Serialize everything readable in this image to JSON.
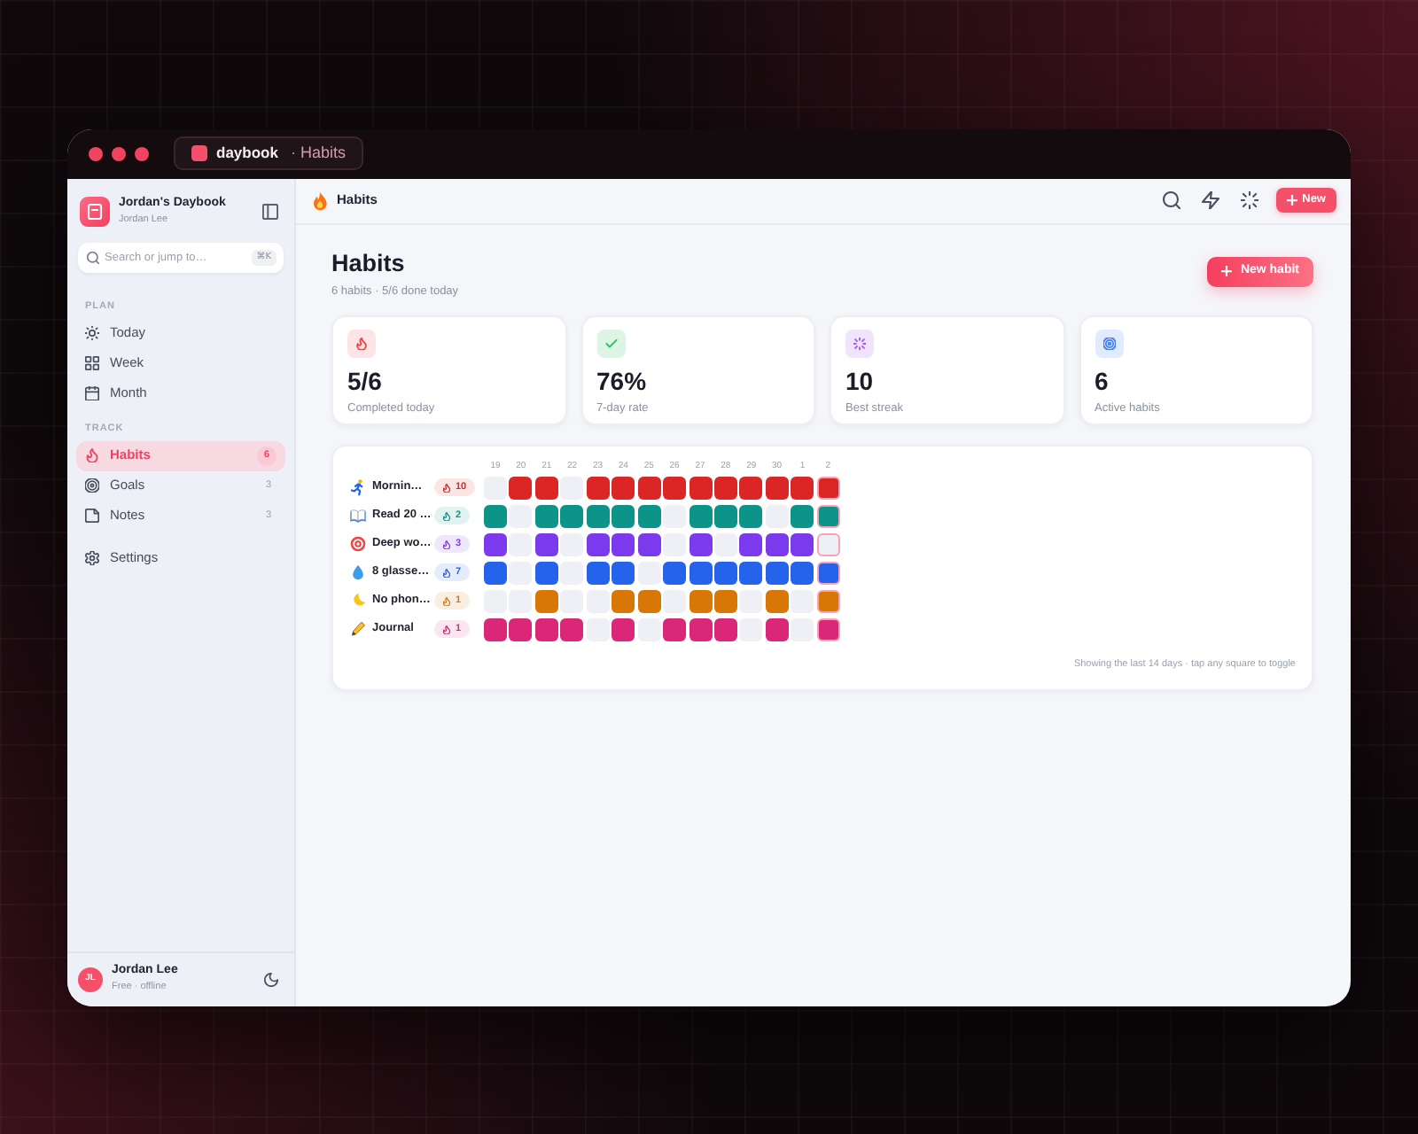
{
  "window": {
    "app_name": "daybook",
    "page_name": "· Habits"
  },
  "sidebar": {
    "workspace": {
      "title": "Jordan's Daybook",
      "subtitle": "Jordan Lee"
    },
    "search": {
      "placeholder": "Search or jump to…",
      "shortcut": "⌘K"
    },
    "sections": [
      {
        "label": "PLAN",
        "items": [
          {
            "label": "Today",
            "selected": false
          },
          {
            "label": "Week",
            "selected": false
          },
          {
            "label": "Month",
            "selected": false
          }
        ]
      },
      {
        "label": "TRACK",
        "items": [
          {
            "label": "Habits",
            "count": "6",
            "selected": true
          },
          {
            "label": "Goals",
            "count": "3",
            "selected": false
          },
          {
            "label": "Notes",
            "count": "3",
            "selected": false
          }
        ]
      },
      {
        "items": [
          {
            "label": "Settings",
            "selected": false
          }
        ]
      }
    ],
    "user": {
      "initials": "JL",
      "name": "Jordan Lee",
      "status": "Free · offline"
    }
  },
  "topbar": {
    "title": "Habits",
    "new_button": "New"
  },
  "page": {
    "title": "Habits",
    "subtitle": "6 habits · 5/6 done today",
    "new_button": "New habit"
  },
  "stats": [
    {
      "value": "5/6",
      "label": "Completed today"
    },
    {
      "value": "76%",
      "label": "7-day rate"
    },
    {
      "value": "10",
      "label": "Best streak"
    },
    {
      "value": "6",
      "label": "Active habits"
    }
  ],
  "tracker": {
    "days": [
      {
        "label": "19",
        "today": false
      },
      {
        "label": "20",
        "today": false
      },
      {
        "label": "21",
        "today": false
      },
      {
        "label": "22",
        "today": false
      },
      {
        "label": "23",
        "today": false
      },
      {
        "label": "24",
        "today": false
      },
      {
        "label": "25",
        "today": false
      },
      {
        "label": "26",
        "today": false
      },
      {
        "label": "27",
        "today": false
      },
      {
        "label": "28",
        "today": false
      },
      {
        "label": "29",
        "today": false
      },
      {
        "label": "30",
        "today": false
      },
      {
        "label": "1",
        "today": false
      },
      {
        "label": "2",
        "today": true
      }
    ],
    "habits": [
      {
        "name": "Mornin…",
        "streak": "10",
        "color": "#dc2626",
        "days": [
          {
            "done": false
          },
          {
            "done": true
          },
          {
            "done": true
          },
          {
            "done": false
          },
          {
            "done": true
          },
          {
            "done": true
          },
          {
            "done": true
          },
          {
            "done": true
          },
          {
            "done": true
          },
          {
            "done": true
          },
          {
            "done": true
          },
          {
            "done": true
          },
          {
            "done": true
          },
          {
            "done": true
          }
        ]
      },
      {
        "name": "Read 20 …",
        "streak": "2",
        "color": "#0d9488",
        "days": [
          {
            "done": true
          },
          {
            "done": false
          },
          {
            "done": true
          },
          {
            "done": true
          },
          {
            "done": true
          },
          {
            "done": true
          },
          {
            "done": true
          },
          {
            "done": false
          },
          {
            "done": true
          },
          {
            "done": true
          },
          {
            "done": true
          },
          {
            "done": false
          },
          {
            "done": true
          },
          {
            "done": true
          }
        ]
      },
      {
        "name": "Deep wo…",
        "streak": "3",
        "color": "#7c3aed",
        "days": [
          {
            "done": true
          },
          {
            "done": false
          },
          {
            "done": true
          },
          {
            "done": false
          },
          {
            "done": true
          },
          {
            "done": true
          },
          {
            "done": true
          },
          {
            "done": false
          },
          {
            "done": true
          },
          {
            "done": false
          },
          {
            "done": true
          },
          {
            "done": true
          },
          {
            "done": true
          },
          {
            "done": false
          }
        ]
      },
      {
        "name": "8 glasse…",
        "streak": "7",
        "color": "#2563eb",
        "days": [
          {
            "done": true
          },
          {
            "done": false
          },
          {
            "done": true
          },
          {
            "done": false
          },
          {
            "done": true
          },
          {
            "done": true
          },
          {
            "done": false
          },
          {
            "done": true
          },
          {
            "done": true
          },
          {
            "done": true
          },
          {
            "done": true
          },
          {
            "done": true
          },
          {
            "done": true
          },
          {
            "done": true
          }
        ]
      },
      {
        "name": "No phon…",
        "streak": "1",
        "color": "#d97706",
        "days": [
          {
            "done": false
          },
          {
            "done": false
          },
          {
            "done": true
          },
          {
            "done": false
          },
          {
            "done": false
          },
          {
            "done": true
          },
          {
            "done": true
          },
          {
            "done": false
          },
          {
            "done": true
          },
          {
            "done": true
          },
          {
            "done": false
          },
          {
            "done": true
          },
          {
            "done": false
          },
          {
            "done": true
          }
        ]
      },
      {
        "name": "Journal",
        "streak": "1",
        "color": "#db2777",
        "days": [
          {
            "done": true
          },
          {
            "done": true
          },
          {
            "done": true
          },
          {
            "done": true
          },
          {
            "done": false
          },
          {
            "done": true
          },
          {
            "done": false
          },
          {
            "done": true
          },
          {
            "done": true
          },
          {
            "done": true
          },
          {
            "done": false
          },
          {
            "done": true
          },
          {
            "done": false
          },
          {
            "done": true
          }
        ]
      }
    ],
    "footnote": "Showing the last 14 days · tap any square to toggle"
  }
}
